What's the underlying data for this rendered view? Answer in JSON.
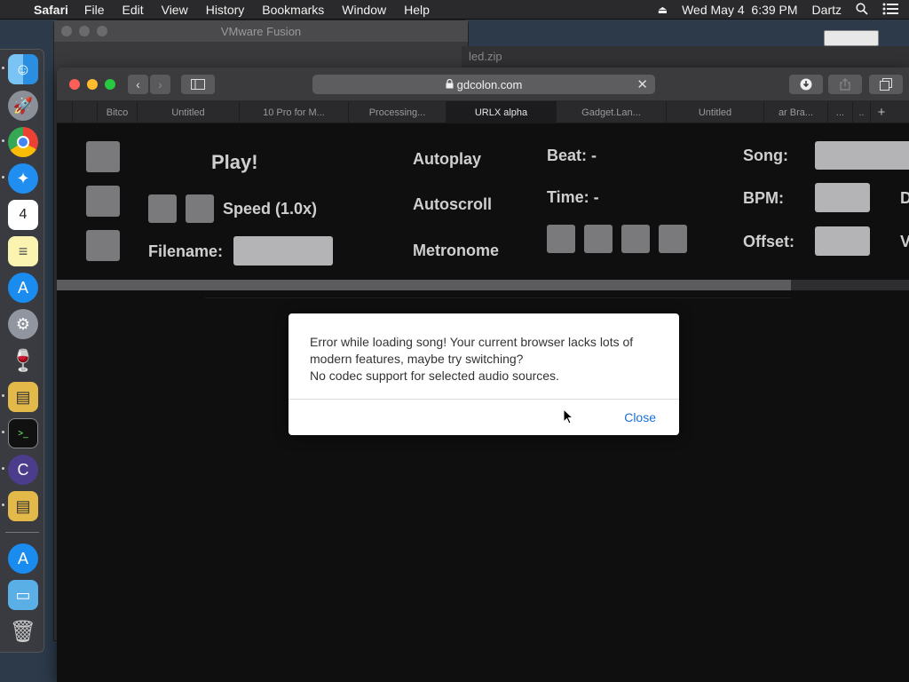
{
  "menubar": {
    "app_name": "Safari",
    "items": [
      "File",
      "Edit",
      "View",
      "History",
      "Bookmarks",
      "Window",
      "Help"
    ],
    "datetime": "Wed May 4  6:39 PM",
    "user": "Dartz"
  },
  "background": {
    "vmware_title": "VMware Fusion",
    "bg_tab_label": "led.zip"
  },
  "safari": {
    "url": "gdcolon.com",
    "tabs": [
      {
        "label": "Bitco",
        "active": false
      },
      {
        "label": "Untitled",
        "active": false
      },
      {
        "label": "10 Pro for M...",
        "active": false
      },
      {
        "label": "Processing...",
        "active": false
      },
      {
        "label": "URLX alpha",
        "active": true
      },
      {
        "label": "Gadget.Lan...",
        "active": false
      },
      {
        "label": "Untitled",
        "active": false
      },
      {
        "label": "ar Bra...",
        "active": false
      },
      {
        "label": "...",
        "active": false
      },
      {
        "label": "..",
        "active": false
      }
    ],
    "new_tab_label": "+"
  },
  "page": {
    "play_label": "Play!",
    "speed_label": "Speed (1.0x)",
    "filename_label": "Filename:",
    "autoplay_label": "Autoplay",
    "autoscroll_label": "Autoscroll",
    "metronome_label": "Metronome",
    "beat_label": "Beat: -",
    "time_label": "Time: -",
    "song_label": "Song:",
    "bpm_label": "BPM:",
    "offset_label": "Offset:",
    "cut_label_1": "D",
    "cut_label_2": "V"
  },
  "alert": {
    "line1": "Error while loading song! Your current browser lacks lots of modern features, maybe try switching?",
    "line2": "No codec support for selected audio sources.",
    "close_label": "Close"
  },
  "colors": {
    "link_blue": "#1a6fd6",
    "traffic_red": "#fe5f57",
    "traffic_yellow": "#febc2e",
    "traffic_green": "#28c840"
  }
}
